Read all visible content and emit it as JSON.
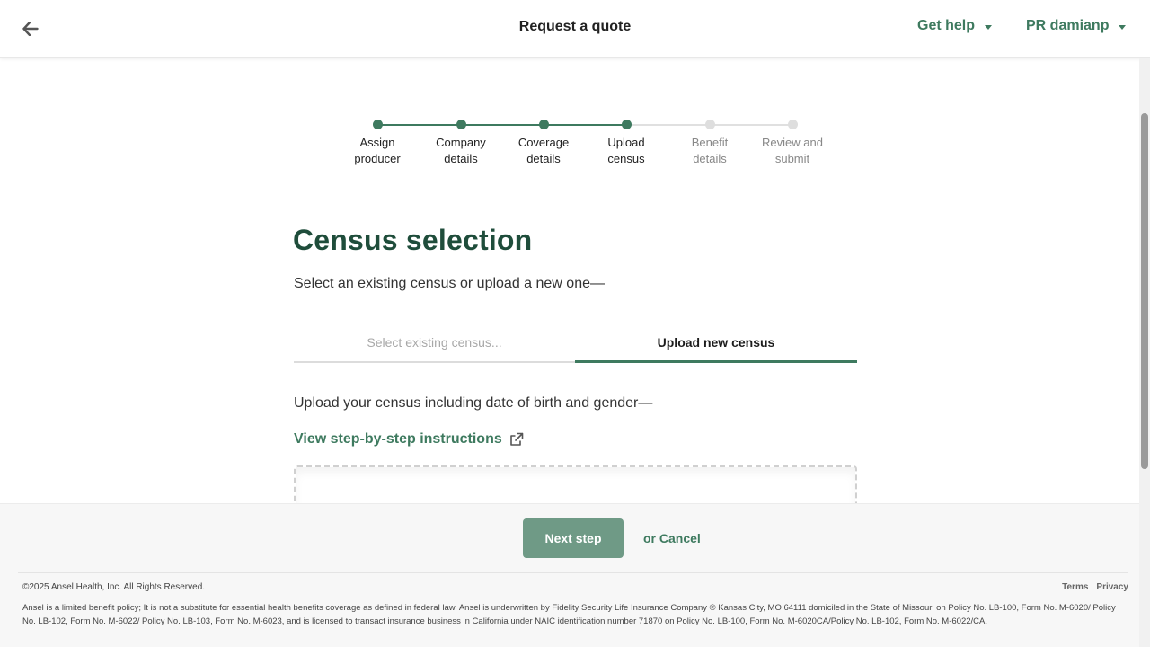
{
  "header": {
    "title": "Request a quote",
    "help_label": "Get help",
    "user_label": "PR damianp"
  },
  "stepper": {
    "steps": [
      {
        "label": "Assign\nproducer",
        "status": "complete"
      },
      {
        "label": "Company\ndetails",
        "status": "complete"
      },
      {
        "label": "Coverage\ndetails",
        "status": "complete"
      },
      {
        "label": "Upload\ncensus",
        "status": "current"
      },
      {
        "label": "Benefit\ndetails",
        "status": "upcoming"
      },
      {
        "label": "Review and\nsubmit",
        "status": "upcoming"
      }
    ]
  },
  "main": {
    "title": "Census selection",
    "subtitle": "Select an existing census or upload a new one—",
    "tabs": [
      {
        "label": "Select existing census...",
        "active": false
      },
      {
        "label": "Upload new census",
        "active": true
      }
    ],
    "upload_intro": "Upload your census including date of birth and gender—",
    "instructions_link": "View step-by-step instructions"
  },
  "actions": {
    "next_label": "Next step",
    "cancel_label": "or Cancel"
  },
  "footer": {
    "copyright": "©2025 Ansel Health, Inc. All Rights Reserved.",
    "links": [
      "Terms",
      "Privacy"
    ],
    "disclaimer": "Ansel is a limited benefit policy; It is not a substitute for essential health benefits coverage as defined in federal law. Ansel is underwritten by Fidelity Security Life Insurance Company ® Kansas City, MO 64111 domiciled in the State of Missouri on Policy No. LB-100, Form No. M-6020/ Policy No. LB-102, Form No. M-6022/ Policy No. LB-103, Form No. M-6023, and is licensed to transact insurance business in California under NAIC identification number 71870 on Policy No. LB-100, Form No. M-6020CA/Policy No. LB-102, Form No. M-6022/CA."
  },
  "colors": {
    "brand_green": "#3e7a5f",
    "title_green": "#1f4d3b",
    "button_green": "#6f9a86"
  }
}
